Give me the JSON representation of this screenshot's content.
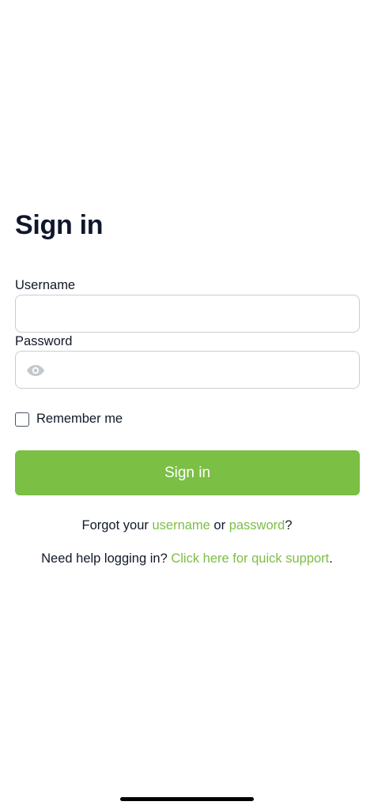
{
  "page": {
    "title": "Sign in"
  },
  "form": {
    "username_label": "Username",
    "username_value": "",
    "password_label": "Password",
    "password_value": "",
    "password_toggle_icon": "eye-icon",
    "remember_label": "Remember me",
    "remember_checked": false,
    "submit_label": "Sign in"
  },
  "links": {
    "forgot_prefix": "Forgot your ",
    "forgot_username": "username",
    "forgot_or": " or ",
    "forgot_password": "password",
    "forgot_suffix": "?",
    "help_prefix": "Need help logging in? ",
    "help_link": "Click here for quick support",
    "help_suffix": "."
  },
  "colors": {
    "accent": "#7bbf44",
    "text": "#111827",
    "border": "#c9ccd1"
  }
}
